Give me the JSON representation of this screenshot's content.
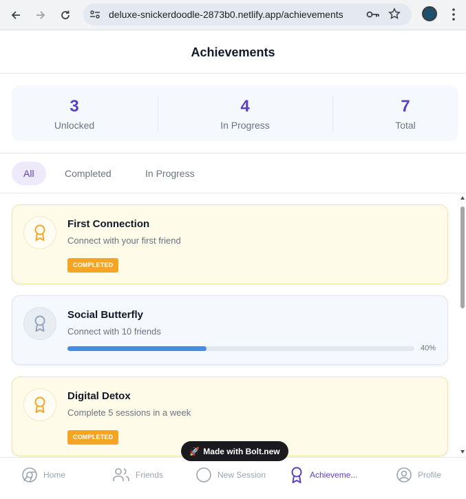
{
  "browser": {
    "url": "deluxe-snickerdoodle-2873b0.netlify.app/achievements"
  },
  "header": {
    "title": "Achievements"
  },
  "stats": [
    {
      "value": "3",
      "label": "Unlocked"
    },
    {
      "value": "4",
      "label": "In Progress"
    },
    {
      "value": "7",
      "label": "Total"
    }
  ],
  "tabs": [
    {
      "label": "All",
      "active": true
    },
    {
      "label": "Completed",
      "active": false
    },
    {
      "label": "In Progress",
      "active": false
    }
  ],
  "achievements": [
    {
      "title": "First Connection",
      "description": "Connect with your first friend",
      "status": "COMPLETED"
    },
    {
      "title": "Social Butterfly",
      "description": "Connect with 10 friends",
      "progress": 0.4,
      "progress_label": "40%"
    },
    {
      "title": "Digital Detox",
      "description": "Complete 5 sessions in a week",
      "status": "COMPLETED"
    }
  ],
  "bottom_nav": [
    {
      "label": "Home",
      "icon": "chrome-home-icon"
    },
    {
      "label": "Friends",
      "icon": "users-icon"
    },
    {
      "label": "New Session",
      "icon": "session-icon"
    },
    {
      "label": "Achieveme...",
      "icon": "award-icon",
      "active": true
    },
    {
      "label": "Profile",
      "icon": "user-circle-icon"
    }
  ],
  "made_with": "Made with Bolt.new",
  "colors": {
    "accent": "#5b3fc4",
    "completed_badge": "#f5a524",
    "progress_bar": "#4a8ae0",
    "completed_card": "#fefbe8",
    "progress_card": "#f5f8fc"
  }
}
